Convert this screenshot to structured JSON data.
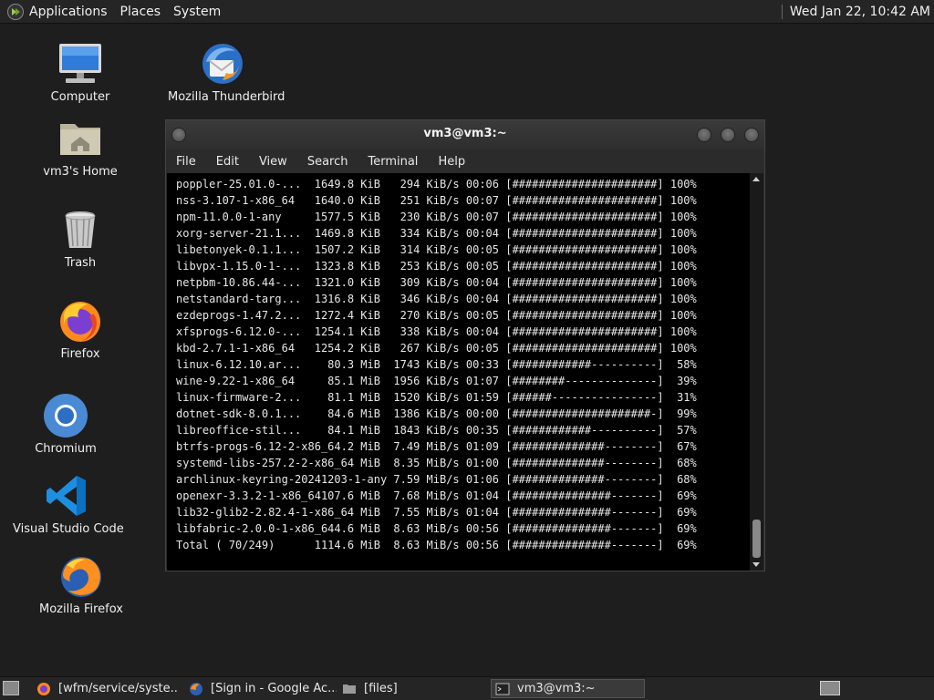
{
  "top_panel": {
    "menus": [
      "Applications",
      "Places",
      "System"
    ],
    "clock": "Wed Jan 22, 10:42 AM"
  },
  "desktop_icons": [
    {
      "label": "Computer",
      "icon": "computer-icon"
    },
    {
      "label": "vm3's Home",
      "icon": "home-folder-icon"
    },
    {
      "label": "Trash",
      "icon": "trash-icon"
    },
    {
      "label": "Firefox",
      "icon": "firefox-icon"
    },
    {
      "label": "Chromium",
      "icon": "chromium-icon"
    },
    {
      "label": "Visual Studio Code",
      "icon": "vscode-icon"
    },
    {
      "label": "Mozilla Firefox",
      "icon": "firefox-icon"
    },
    {
      "label": "Mozilla Thunderbird",
      "icon": "thunderbird-icon"
    }
  ],
  "terminal": {
    "title": "vm3@vm3:~",
    "menu": [
      "File",
      "Edit",
      "View",
      "Search",
      "Terminal",
      "Help"
    ],
    "lines": [
      "poppler-25.01.0-...  1649.8 KiB   294 KiB/s 00:06 [######################] 100%",
      "nss-3.107-1-x86_64   1640.0 KiB   251 KiB/s 00:07 [######################] 100%",
      "npm-11.0.0-1-any     1577.5 KiB   230 KiB/s 00:07 [######################] 100%",
      "xorg-server-21.1...  1469.8 KiB   334 KiB/s 00:04 [######################] 100%",
      "libetonyek-0.1.1...  1507.2 KiB   314 KiB/s 00:05 [######################] 100%",
      "libvpx-1.15.0-1-...  1323.8 KiB   253 KiB/s 00:05 [######################] 100%",
      "netpbm-10.86.44-...  1321.0 KiB   309 KiB/s 00:04 [######################] 100%",
      "netstandard-targ...  1316.8 KiB   346 KiB/s 00:04 [######################] 100%",
      "ezdeprogs-1.47.2...  1272.4 KiB   270 KiB/s 00:05 [######################] 100%",
      "xfsprogs-6.12.0-...  1254.1 KiB   338 KiB/s 00:04 [######################] 100%",
      "kbd-2.7.1-1-x86_64   1254.2 KiB   267 KiB/s 00:05 [######################] 100%",
      "linux-6.12.10.ar...    80.3 MiB  1743 KiB/s 00:33 [############----------]  58%",
      "wine-9.22-1-x86_64     85.1 MiB  1956 KiB/s 01:07 [########--------------]  39%",
      "linux-firmware-2...    81.1 MiB  1520 KiB/s 01:59 [######----------------]  31%",
      "dotnet-sdk-8.0.1...    84.6 MiB  1386 KiB/s 00:00 [#####################-]  99%",
      "libreoffice-stil...    84.1 MiB  1843 KiB/s 00:35 [############----------]  57%",
      "btrfs-progs-6.12-2-x86_64.2 MiB  7.49 MiB/s 01:09 [##############--------]  67%",
      "systemd-libs-257.2-2-x86_64 MiB  8.35 MiB/s 01:00 [##############--------]  68%",
      "archlinux-keyring-20241203-1-any 7.59 MiB/s 01:06 [##############--------]  68%",
      "openexr-3.3.2-1-x86_64107.6 MiB  7.68 MiB/s 01:04 [###############-------]  69%",
      "lib32-glib2-2.82.4-1-x86_64 MiB  7.55 MiB/s 01:04 [###############-------]  69%",
      "libfabric-2.0.0-1-x86_644.6 MiB  8.63 MiB/s 00:56 [###############-------]  69%",
      "Total ( 70/249)      1114.6 MiB  8.63 MiB/s 00:56 [###############-------]  69%"
    ]
  },
  "taskbar": {
    "tasks": [
      {
        "label": "[wfm/service/syste...",
        "icon": "firefox-icon"
      },
      {
        "label": "[Sign in - Google Ac...",
        "icon": "firefox-icon"
      },
      {
        "label": "[files]",
        "icon": "folder-icon"
      },
      {
        "label": "vm3@vm3:~",
        "icon": "terminal-icon"
      }
    ]
  }
}
